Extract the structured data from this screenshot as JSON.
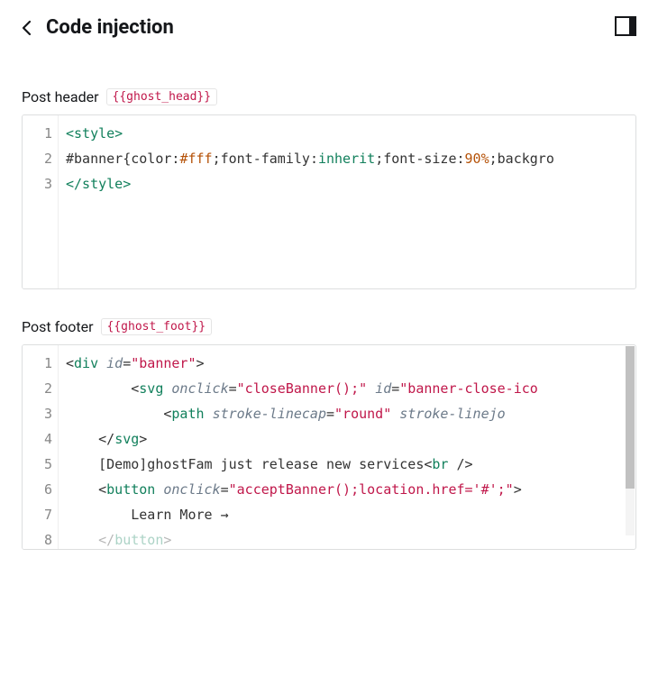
{
  "header": {
    "title": "Code injection"
  },
  "section_header": {
    "label": "Post header",
    "tag": "{{ghost_head}}",
    "lines": [
      "1",
      "2",
      "3"
    ],
    "code": {
      "l1": "<style>",
      "l2_a": "#banner",
      "l2_b": "{",
      "l2_c": "color",
      "l2_d": ":",
      "l2_e": "#fff",
      "l2_f": ";",
      "l2_g": "font-family",
      "l2_h": ":",
      "l2_i": "inherit",
      "l2_j": ";",
      "l2_k": "font-size",
      "l2_l": ":",
      "l2_m": "90%",
      "l2_n": ";backgro",
      "l3": "</style>"
    }
  },
  "section_footer": {
    "label": "Post footer",
    "tag": "{{ghost_foot}}",
    "lines": [
      "1",
      "2",
      "3",
      "4",
      "5",
      "6",
      "7",
      "8"
    ],
    "code": {
      "l1_a": "<",
      "l1_b": "div",
      "l1_c": " ",
      "l1_d": "id",
      "l1_e": "=",
      "l1_f": "\"banner\"",
      "l1_g": ">",
      "l2_a": "        <",
      "l2_b": "svg",
      "l2_c": " ",
      "l2_d": "onclick",
      "l2_e": "=",
      "l2_f": "\"closeBanner();\"",
      "l2_g": " ",
      "l2_h": "id",
      "l2_i": "=",
      "l2_j": "\"banner-close-ico",
      "l3_a": "            <",
      "l3_b": "path",
      "l3_c": " ",
      "l3_d": "stroke-linecap",
      "l3_e": "=",
      "l3_f": "\"round\"",
      "l3_g": " ",
      "l3_h": "stroke-linejo",
      "l4_a": "    </",
      "l4_b": "svg",
      "l4_c": ">",
      "l5_a": "    [Demo]ghostFam just release new services",
      "l5_b": "<",
      "l5_c": "br",
      "l5_d": " />",
      "l6_a": "    <",
      "l6_b": "button",
      "l6_c": " ",
      "l6_d": "onclick",
      "l6_e": "=",
      "l6_f": "\"acceptBanner();location.href='#';\"",
      "l6_g": ">",
      "l7": "        Learn More →",
      "l8_a": "    </",
      "l8_b": "button",
      "l8_c": ">"
    }
  }
}
